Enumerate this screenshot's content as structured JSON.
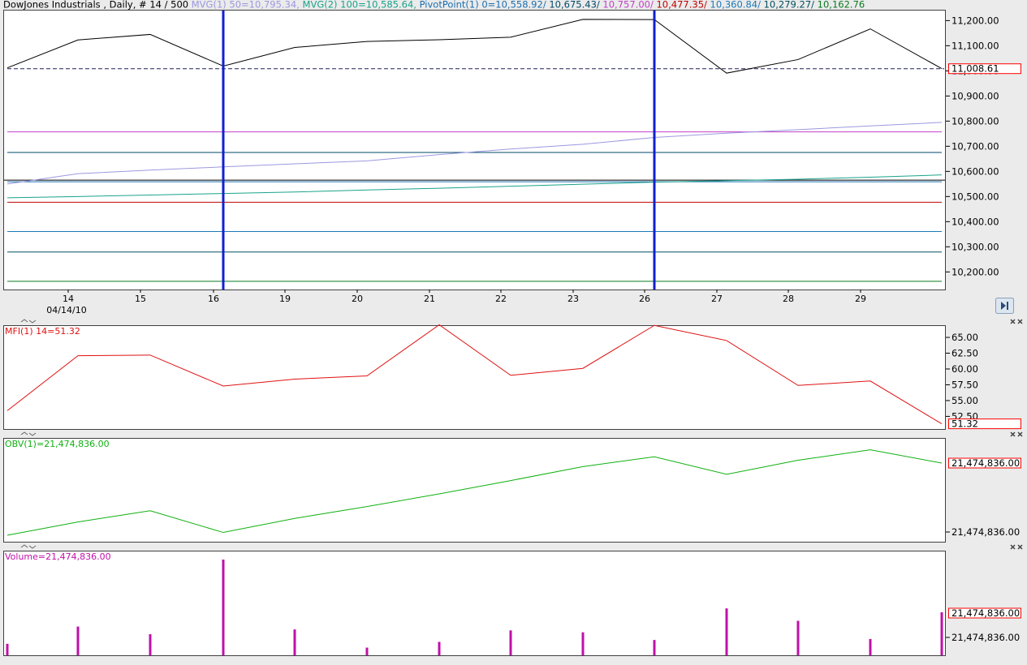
{
  "header": {
    "segments": [
      {
        "text": "DowJones Industrials , Daily, # 14 / 500",
        "color": "#000000"
      },
      {
        "text": "MVG(1) 50=10,795.34,",
        "color": "#9c98e0"
      },
      {
        "text": "MVG(2) 100=10,585.64,",
        "color": "#1aa38a"
      },
      {
        "text": "PivotPoint(1) 0=10,558.92/",
        "color": "#1a6fb0"
      },
      {
        "text": "10,675.43/",
        "color": "#004a6a"
      },
      {
        "text": "10,757.00/",
        "color": "#c040c8"
      },
      {
        "text": "10,477.35/",
        "color": "#c00000"
      },
      {
        "text": "10,360.84/",
        "color": "#1a7ab8"
      },
      {
        "text": "10,279.27/",
        "color": "#005060"
      },
      {
        "text": "10,162.76",
        "color": "#0a7a20"
      }
    ]
  },
  "colors": {
    "price": "#000000",
    "mvg1": "#9c98e0",
    "mvg2": "#1aa38a",
    "vline": "#1020d0",
    "mfi": "#e01010",
    "obv": "#10b010",
    "volume": "#c010a8",
    "box": "#ff0000"
  },
  "chart_data": [
    {
      "type": "line",
      "title": "DowJones Industrials , Daily, # 14 / 500",
      "x": [
        "14",
        "15",
        "16",
        "19",
        "20",
        "21",
        "22",
        "23",
        "26",
        "27",
        "28",
        "29",
        "30"
      ],
      "x_tick_labels": [
        "14",
        "15",
        "16",
        "19",
        "20",
        "21",
        "22",
        "23",
        "26",
        "27",
        "28",
        "29"
      ],
      "date_label": "04/14/10",
      "ylim": [
        10130,
        11240
      ],
      "y_ticks": [
        10200,
        10300,
        10400,
        10500,
        10600,
        10700,
        10800,
        10900,
        11000,
        11100,
        11200
      ],
      "y_tick_labels": [
        "10,200.00",
        "10,300.00",
        "10,400.00",
        "10,500.00",
        "10,600.00",
        "10,700.00",
        "10,800.00",
        "10,900.00",
        "11,000.00",
        "11,100.00",
        "11,200.00"
      ],
      "series": [
        {
          "name": "DowJones Industrials",
          "values": [
            11123,
            11145,
            11019,
            11093,
            11117,
            11124,
            11134,
            11205,
            11204,
            10991,
            11045,
            11167,
            11009
          ]
        },
        {
          "name": "MVG(1) 50",
          "values": [
            10591,
            10605,
            10618,
            10630,
            10642,
            10667,
            10689,
            10708,
            10735,
            10752,
            10766,
            10781,
            10795
          ]
        },
        {
          "name": "MVG(2) 100",
          "values": [
            10500,
            10506,
            10512,
            10518,
            10526,
            10533,
            10541,
            10549,
            10557,
            10563,
            10569,
            10577,
            10586
          ]
        }
      ],
      "start_values": {
        "price": 11012,
        "mvg1": 10550,
        "mvg2": 10495
      },
      "pivot_levels": [
        {
          "value": 10558.92,
          "color": "#1a6fb0"
        },
        {
          "value": 10675.43,
          "color": "#004a6a"
        },
        {
          "value": 10757.0,
          "color": "#c040c8"
        },
        {
          "value": 10477.35,
          "color": "#c00000"
        },
        {
          "value": 10360.84,
          "color": "#1a7ab8"
        },
        {
          "value": 10279.27,
          "color": "#005060"
        },
        {
          "value": 10162.76,
          "color": "#0a7a20"
        }
      ],
      "current_price": 11008.61,
      "current_label": "11,008.61",
      "vertical_markers": [
        "16",
        "26"
      ]
    },
    {
      "type": "line",
      "title": "MFI(1) 14=51.32",
      "ylim": [
        50.5,
        66.8
      ],
      "y_ticks": [
        52.5,
        55,
        57.5,
        60,
        62.5,
        65
      ],
      "y_tick_labels": [
        "52.50",
        "55.00",
        "57.50",
        "60.00",
        "62.50",
        "65.00"
      ],
      "series": [
        {
          "name": "MFI(1) 14",
          "values": [
            53.4,
            62.1,
            62.2,
            57.3,
            58.4,
            58.9,
            67.0,
            59.0,
            60.1,
            66.9,
            64.5,
            57.4,
            58.1,
            51.32
          ]
        }
      ],
      "current_label": "51.32"
    },
    {
      "type": "line",
      "title": "OBV(1)=21,474,836.00",
      "y_tick_labels": [
        "21,474,836.00"
      ],
      "series": [
        {
          "name": "OBV(1)",
          "values": [
            0.0,
            0.19,
            0.35,
            0.04,
            0.24,
            0.41,
            0.59,
            0.78,
            0.98,
            1.12,
            0.87,
            1.07,
            1.22,
            1.03
          ]
        }
      ],
      "current_label": "21,474,836.00"
    },
    {
      "type": "bar",
      "title": "Volume=21,474,836.00",
      "y_tick_labels": [
        "21,474,836.00"
      ],
      "values": [
        0.12,
        0.3,
        0.22,
        1.0,
        0.27,
        0.08,
        0.14,
        0.26,
        0.24,
        0.16,
        0.49,
        0.36,
        0.17,
        0.45
      ],
      "current_label": "21,474,836.00"
    }
  ]
}
